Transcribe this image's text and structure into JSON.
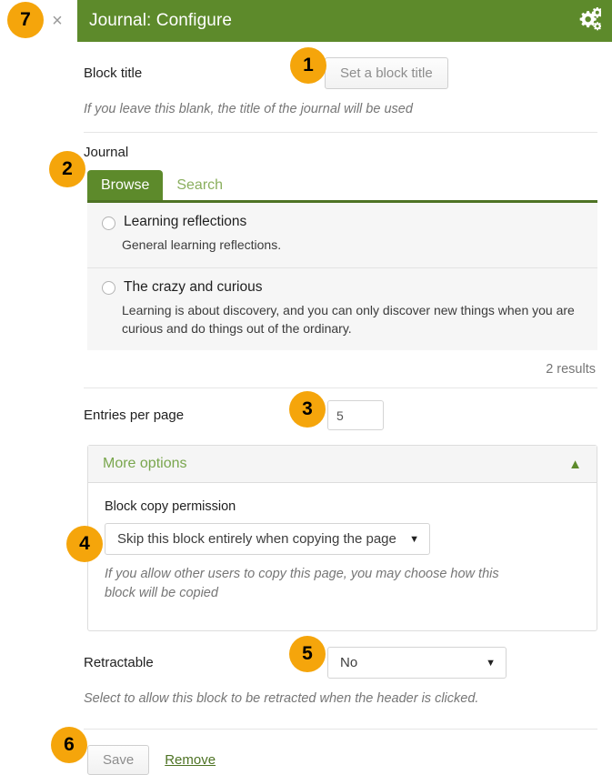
{
  "header": {
    "title": "Journal: Configure",
    "close_label": "×",
    "settings_icon": "cogs-icon"
  },
  "block_title": {
    "label": "Block title",
    "button_label": "Set a block title",
    "help": "If you leave this blank, the title of the journal will be used"
  },
  "journal": {
    "label": "Journal",
    "tabs": [
      {
        "label": "Browse",
        "active": true
      },
      {
        "label": "Search",
        "active": false
      }
    ],
    "results": [
      {
        "title": "Learning reflections",
        "description": "General learning reflections.",
        "selected": false
      },
      {
        "title": "The crazy and curious",
        "description": "Learning is about discovery, and you can only discover new things when you are curious and do things out of the ordinary.",
        "selected": false
      }
    ],
    "results_count": "2 results"
  },
  "entries_per_page": {
    "label": "Entries per page",
    "value": "5"
  },
  "more_options": {
    "title": "More options",
    "chevron": "▲",
    "block_copy_permission": {
      "label": "Block copy permission",
      "value": "Skip this block entirely when copying the page",
      "caret": "▼",
      "help": "If you allow other users to copy this page, you may choose how this block will be copied"
    }
  },
  "retractable": {
    "label": "Retractable",
    "value": "No",
    "caret": "▼",
    "help": "Select to allow this block to be retracted when the header is clicked."
  },
  "footer": {
    "save_label": "Save",
    "remove_label": "Remove"
  },
  "callouts": {
    "one": "1",
    "two": "2",
    "three": "3",
    "four": "4",
    "five": "5",
    "six": "6",
    "seven": "7"
  },
  "colors": {
    "brand_green": "#5d8a2b",
    "badge_orange": "#f5a50b",
    "link_green": "#4e7324"
  }
}
